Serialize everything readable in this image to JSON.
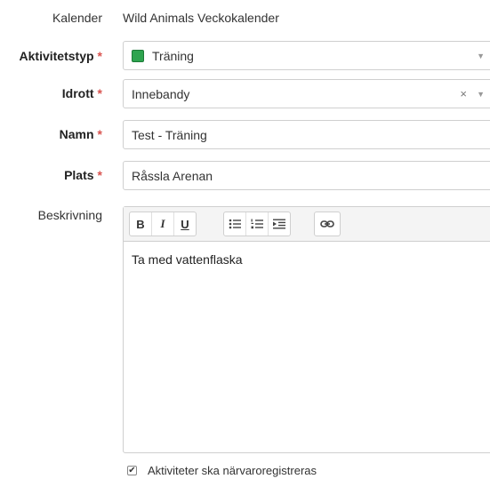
{
  "kalender": {
    "label": "Kalender",
    "value": "Wild Animals Veckokalender"
  },
  "aktivitetstyp": {
    "label": "Aktivitetstyp",
    "required": "*",
    "value": "Träning",
    "color": "#2ea44f",
    "arrow": "▼"
  },
  "idrott": {
    "label": "Idrott",
    "required": "*",
    "value": "Innebandy",
    "clear": "×",
    "arrow": "▼"
  },
  "namn": {
    "label": "Namn",
    "required": "*",
    "value": "Test - Träning"
  },
  "plats": {
    "label": "Plats",
    "required": "*",
    "value": "Råssla Arenan"
  },
  "beskrivning": {
    "label": "Beskrivning",
    "toolbar": {
      "bold": "B",
      "italic": "I",
      "underline": "U"
    },
    "content": "Ta med vattenflaska"
  },
  "attendance": {
    "label": "Aktiviteter ska närvaroregistreras",
    "checked": true
  }
}
